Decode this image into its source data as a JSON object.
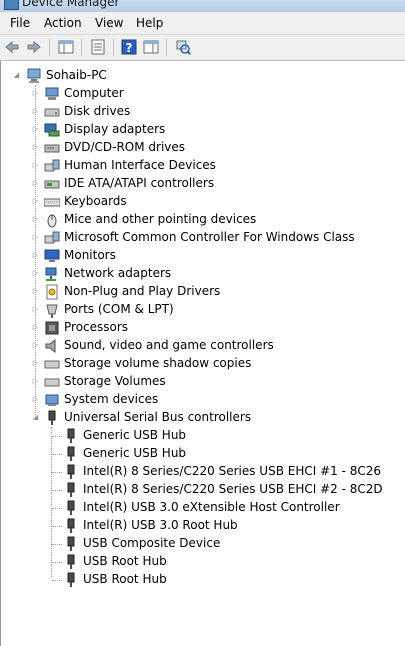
{
  "window": {
    "title": "Device Manager"
  },
  "menu": [
    "File",
    "Action",
    "View",
    "Help"
  ],
  "toolbar": [
    "back-icon",
    "forward-icon",
    "show-hide-console-tree-icon",
    "properties-icon",
    "help-icon",
    "action-pane-icon",
    "scan-hardware-icon"
  ],
  "tree": {
    "root": "Sohaib-PC",
    "categories": [
      {
        "label": "Computer",
        "icon": "computer-icon"
      },
      {
        "label": "Disk drives",
        "icon": "disk-drive-icon"
      },
      {
        "label": "Display adapters",
        "icon": "display-adapter-icon"
      },
      {
        "label": "DVD/CD-ROM drives",
        "icon": "dvd-drive-icon"
      },
      {
        "label": "Human Interface Devices",
        "icon": "hid-icon"
      },
      {
        "label": "IDE ATA/ATAPI controllers",
        "icon": "ide-controller-icon"
      },
      {
        "label": "Keyboards",
        "icon": "keyboard-icon"
      },
      {
        "label": "Mice and other pointing devices",
        "icon": "mouse-icon"
      },
      {
        "label": "Microsoft Common Controller For Windows Class",
        "icon": "controller-icon"
      },
      {
        "label": "Monitors",
        "icon": "monitor-icon"
      },
      {
        "label": "Network adapters",
        "icon": "network-adapter-icon"
      },
      {
        "label": "Non-Plug and Play Drivers",
        "icon": "non-pnp-icon"
      },
      {
        "label": "Ports (COM & LPT)",
        "icon": "port-icon"
      },
      {
        "label": "Processors",
        "icon": "processor-icon"
      },
      {
        "label": "Sound, video and game controllers",
        "icon": "sound-icon"
      },
      {
        "label": "Storage volume shadow copies",
        "icon": "storage-icon"
      },
      {
        "label": "Storage Volumes",
        "icon": "storage-icon"
      },
      {
        "label": "System devices",
        "icon": "system-devices-icon"
      },
      {
        "label": "Universal Serial Bus controllers",
        "icon": "usb-icon",
        "expanded": true
      }
    ],
    "usb_children": [
      "Generic USB Hub",
      "Generic USB Hub",
      "Intel(R) 8 Series/C220 Series USB EHCI #1 - 8C26",
      "Intel(R) 8 Series/C220 Series USB EHCI #2 - 8C2D",
      "Intel(R) USB 3.0 eXtensible Host Controller",
      "Intel(R) USB 3.0 Root Hub",
      "USB Composite Device",
      "USB Root Hub",
      "USB Root Hub"
    ]
  }
}
